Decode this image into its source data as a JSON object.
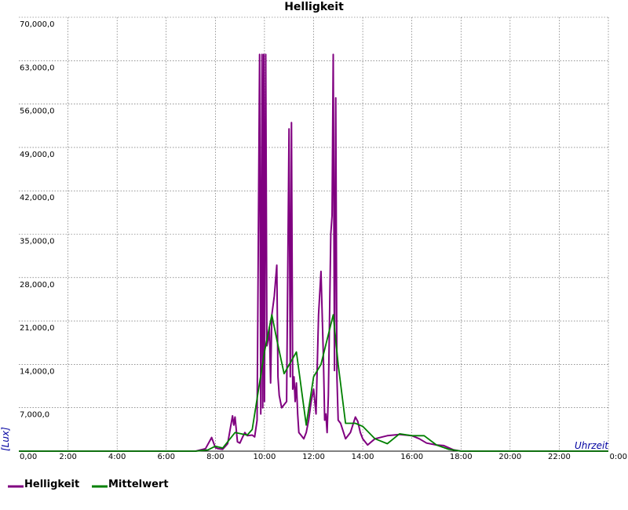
{
  "chart_data": {
    "type": "line",
    "title": "Helligkeit",
    "xlabel": "Uhrzeit",
    "ylabel": "[Lux]",
    "xlim": [
      0,
      24
    ],
    "ylim": [
      0,
      70000
    ],
    "x_unit": "hours",
    "grid": true,
    "legend_position": "bottom-left",
    "x_ticks": [
      {
        "value": 0,
        "label": "0,00"
      },
      {
        "value": 2,
        "label": "2:00"
      },
      {
        "value": 4,
        "label": "4:00"
      },
      {
        "value": 6,
        "label": "6:00"
      },
      {
        "value": 8,
        "label": "8:00"
      },
      {
        "value": 10,
        "label": "10:00"
      },
      {
        "value": 12,
        "label": "12:00"
      },
      {
        "value": 14,
        "label": "14:00"
      },
      {
        "value": 16,
        "label": "16:00"
      },
      {
        "value": 18,
        "label": "18:00"
      },
      {
        "value": 20,
        "label": "20:00"
      },
      {
        "value": 22,
        "label": "22:00"
      },
      {
        "value": 24,
        "label": "0:00"
      }
    ],
    "y_ticks": [
      {
        "value": 7000,
        "label": "7,000,0"
      },
      {
        "value": 14000,
        "label": "14,000,0"
      },
      {
        "value": 21000,
        "label": "21,000,0"
      },
      {
        "value": 28000,
        "label": "28,000,0"
      },
      {
        "value": 35000,
        "label": "35,000,0"
      },
      {
        "value": 42000,
        "label": "42,000,0"
      },
      {
        "value": 49000,
        "label": "49,000,0"
      },
      {
        "value": 56000,
        "label": "56,000,0"
      },
      {
        "value": 63000,
        "label": "63,000,0"
      },
      {
        "value": 70000,
        "label": "70,000,0"
      }
    ],
    "series": [
      {
        "name": "Helligkeit",
        "color": "#800080",
        "x": [
          0,
          7.2,
          7.6,
          7.85,
          8.0,
          8.1,
          8.3,
          8.5,
          8.7,
          8.75,
          8.8,
          8.9,
          9.0,
          9.1,
          9.2,
          9.3,
          9.5,
          9.6,
          9.7,
          9.8,
          9.85,
          9.9,
          9.93,
          9.97,
          10.0,
          10.05,
          10.1,
          10.15,
          10.2,
          10.25,
          10.3,
          10.4,
          10.5,
          10.55,
          10.6,
          10.7,
          10.8,
          10.9,
          11.0,
          11.05,
          11.1,
          11.15,
          11.2,
          11.25,
          11.3,
          11.35,
          11.4,
          11.5,
          11.6,
          11.7,
          11.8,
          11.9,
          12.0,
          12.1,
          12.2,
          12.3,
          12.4,
          12.45,
          12.5,
          12.55,
          12.6,
          12.7,
          12.75,
          12.8,
          12.85,
          12.9,
          12.95,
          13.0,
          13.1,
          13.3,
          13.5,
          13.7,
          13.8,
          13.9,
          14.0,
          14.2,
          14.5,
          15.0,
          15.5,
          16.0,
          16.3,
          16.6,
          17.0,
          17.3,
          17.7,
          18.0,
          24
        ],
        "values": [
          0,
          0,
          400,
          2200,
          600,
          400,
          300,
          1200,
          5700,
          4200,
          5500,
          1500,
          1300,
          2200,
          3000,
          2500,
          2600,
          2300,
          5000,
          64000,
          6000,
          64000,
          7000,
          64000,
          8000,
          64000,
          17000,
          18000,
          20000,
          11000,
          22000,
          25000,
          30000,
          12000,
          9000,
          7000,
          7500,
          8000,
          52000,
          12000,
          53000,
          10000,
          12000,
          8000,
          11000,
          6000,
          3000,
          2500,
          2000,
          3000,
          5000,
          8000,
          10000,
          6000,
          22000,
          29000,
          15000,
          5000,
          6000,
          3000,
          9000,
          35000,
          38000,
          64000,
          13000,
          57000,
          12000,
          5000,
          4500,
          2000,
          3000,
          5500,
          4800,
          3000,
          2000,
          1000,
          2000,
          2500,
          2700,
          2500,
          2000,
          1300,
          1000,
          900,
          200,
          0,
          0
        ]
      },
      {
        "name": "Mittelwert",
        "color": "#008000",
        "x": [
          0,
          7.2,
          7.7,
          8.0,
          8.3,
          8.8,
          9.3,
          9.5,
          10.0,
          10.3,
          10.5,
          10.8,
          11.3,
          11.7,
          12.0,
          12.3,
          12.8,
          13.0,
          13.3,
          13.7,
          14.0,
          14.5,
          15.0,
          15.5,
          16.0,
          16.5,
          17.0,
          17.5,
          18.0,
          24
        ],
        "values": [
          0,
          0,
          200,
          800,
          500,
          3000,
          2600,
          3500,
          16000,
          22000,
          18000,
          12500,
          16000,
          4200,
          12000,
          14000,
          22000,
          14000,
          4500,
          4500,
          4000,
          2000,
          1200,
          2800,
          2500,
          2500,
          1000,
          300,
          0,
          0
        ]
      }
    ]
  }
}
